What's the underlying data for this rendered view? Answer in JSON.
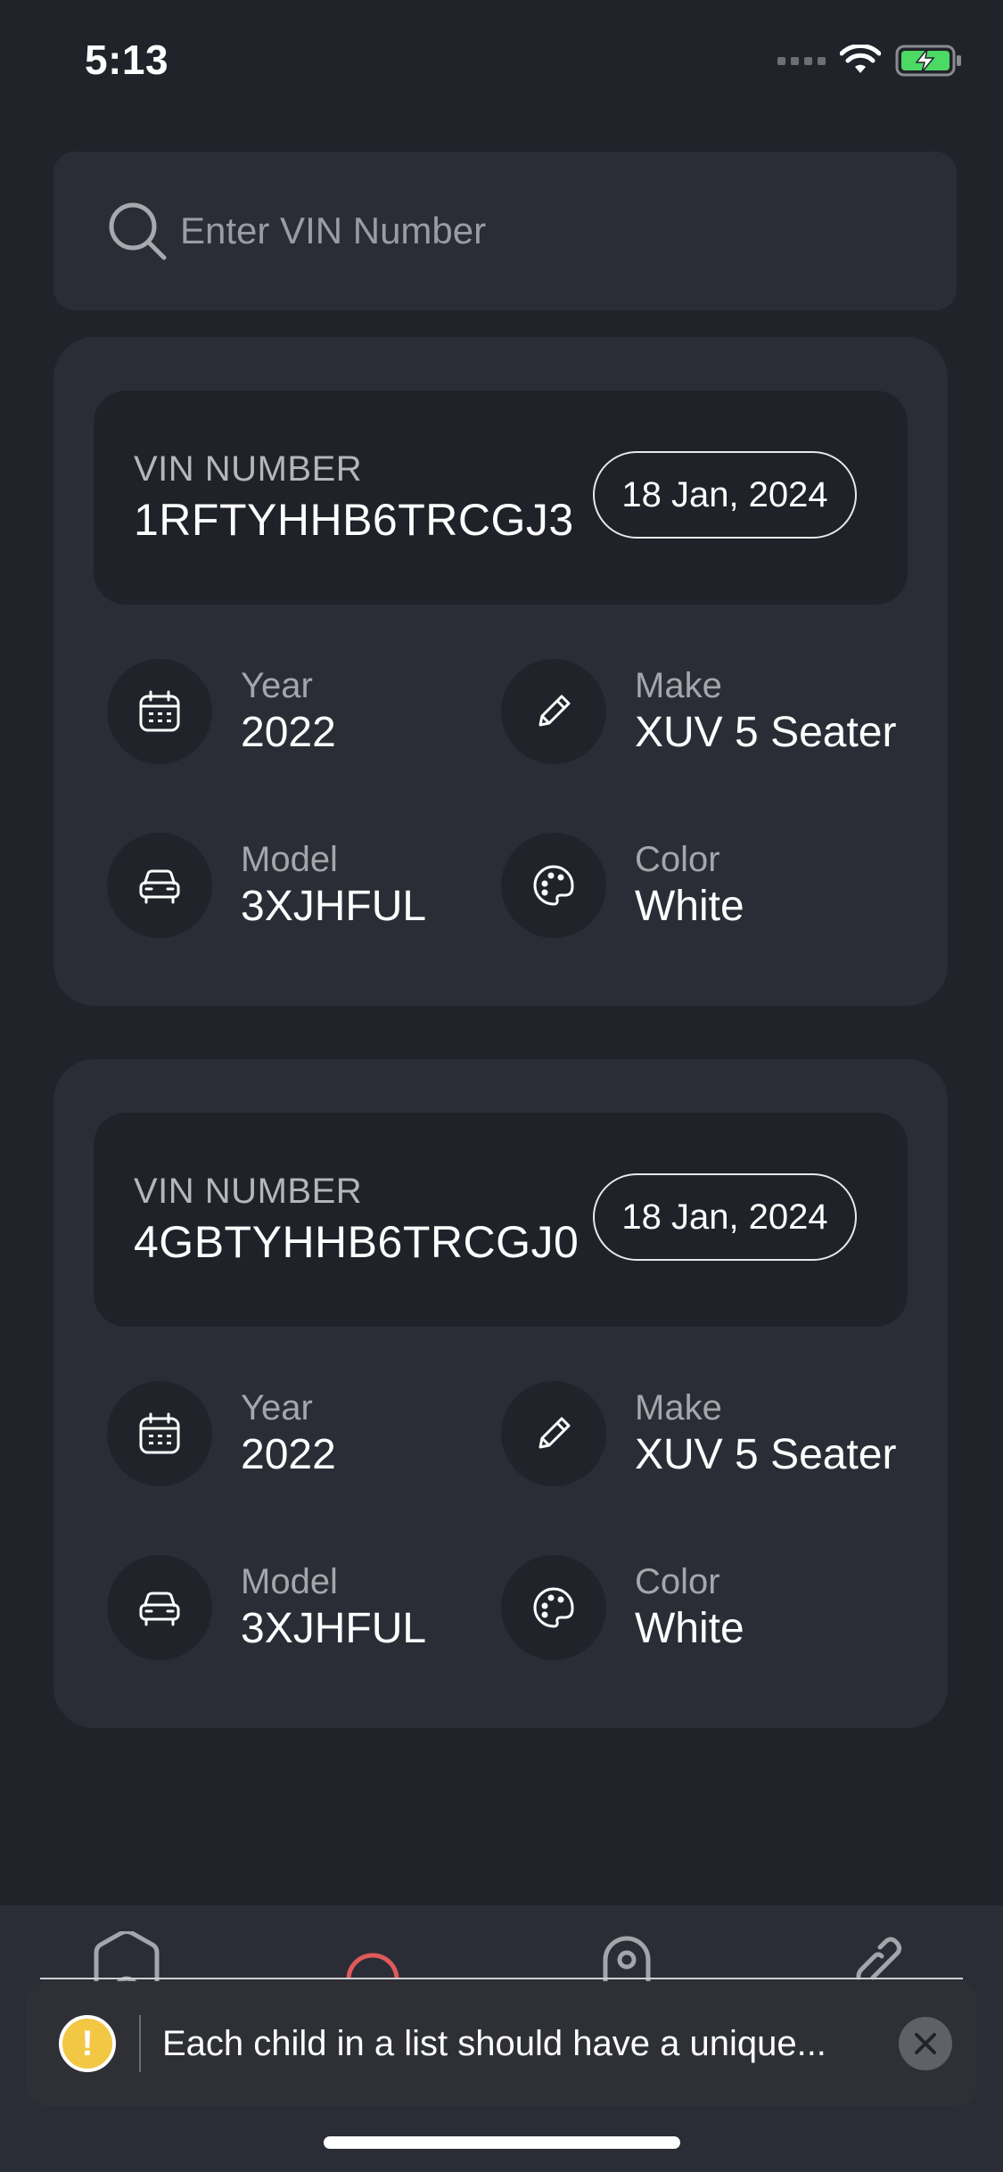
{
  "status_bar": {
    "time": "5:13"
  },
  "search": {
    "placeholder": "Enter VIN Number",
    "value": ""
  },
  "cards": [
    {
      "vin_label": "VIN NUMBER",
      "vin": "1RFTYHHB6TRCGJ3",
      "date": "18 Jan, 2024",
      "year_label": "Year",
      "year": "2022",
      "make_label": "Make",
      "make": "XUV 5 Seater",
      "model_label": "Model",
      "model": "3XJHFUL",
      "color_label": "Color",
      "color": "White"
    },
    {
      "vin_label": "VIN NUMBER",
      "vin": "4GBTYHHB6TRCGJ0",
      "date": "18 Jan, 2024",
      "year_label": "Year",
      "year": "2022",
      "make_label": "Make",
      "make": "XUV 5 Seater",
      "model_label": "Model",
      "model": "3XJHFUL",
      "color_label": "Color",
      "color": "White"
    }
  ],
  "tab_bar": {
    "icons": [
      "home-icon",
      "circle-icon",
      "location-icon",
      "link-icon"
    ],
    "active_color": "#e05a5a"
  },
  "toast": {
    "message": "Each child in a list should have a unique...",
    "icon": "warning-icon"
  },
  "colors": {
    "background": "#21232b",
    "card": "#2b2d36",
    "panel": "#202229",
    "warning": "#f2c744",
    "battery": "#4cd964"
  }
}
